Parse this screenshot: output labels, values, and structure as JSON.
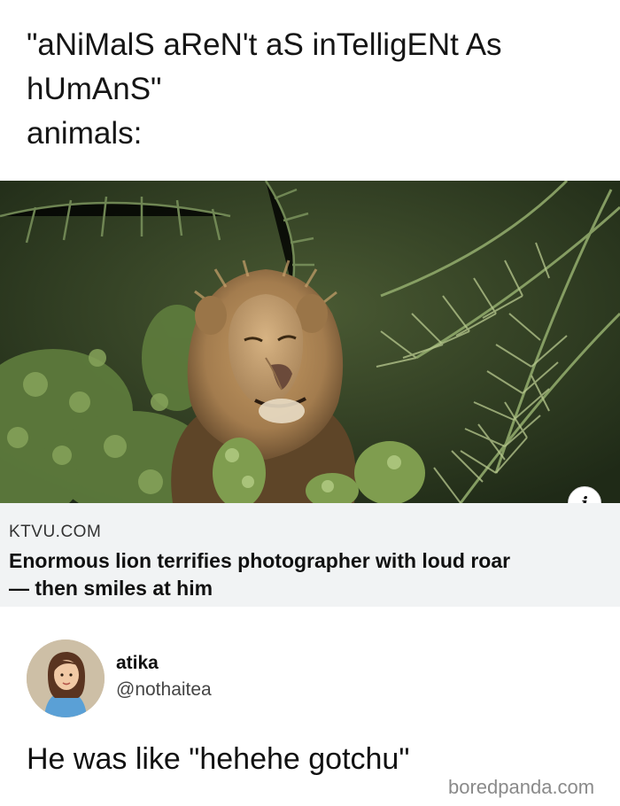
{
  "caption": {
    "line1": "\"aNiMalS aReN't aS inTelligENt As",
    "line2": "hUmAnS\"",
    "line3": "animals:"
  },
  "link_preview": {
    "info_icon": "info-icon",
    "info_glyph": "i",
    "source": "KTVU.COM",
    "title_line1": "Enormous lion terrifies photographer with loud roar",
    "title_line2": "— then smiles at him"
  },
  "tweet": {
    "name": "atika",
    "handle": "@nothaitea",
    "text": "He was like \"hehehe gotchu\""
  },
  "watermark": "boredpanda.com",
  "colors": {
    "card_background": "#f1f3f4",
    "foliage_dark": "#2d3a24",
    "lion_mane": "#a37c4e"
  }
}
